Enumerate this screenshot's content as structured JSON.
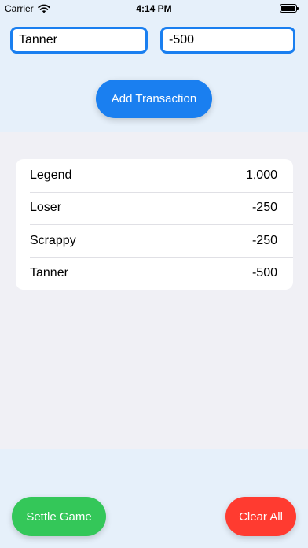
{
  "status_bar": {
    "carrier": "Carrier",
    "time": "4:14 PM"
  },
  "form": {
    "name_value": "Tanner",
    "amount_value": "-500",
    "add_button_label": "Add Transaction"
  },
  "transactions": [
    {
      "name": "Legend",
      "amount": "1,000"
    },
    {
      "name": "Loser",
      "amount": "-250"
    },
    {
      "name": "Scrappy",
      "amount": "-250"
    },
    {
      "name": "Tanner",
      "amount": "-500"
    }
  ],
  "footer": {
    "settle_label": "Settle Game",
    "clear_label": "Clear All"
  },
  "colors": {
    "accent": "#1a7ff0",
    "settle": "#34c759",
    "clear": "#ff3b30",
    "background": "#e6f0fa"
  }
}
